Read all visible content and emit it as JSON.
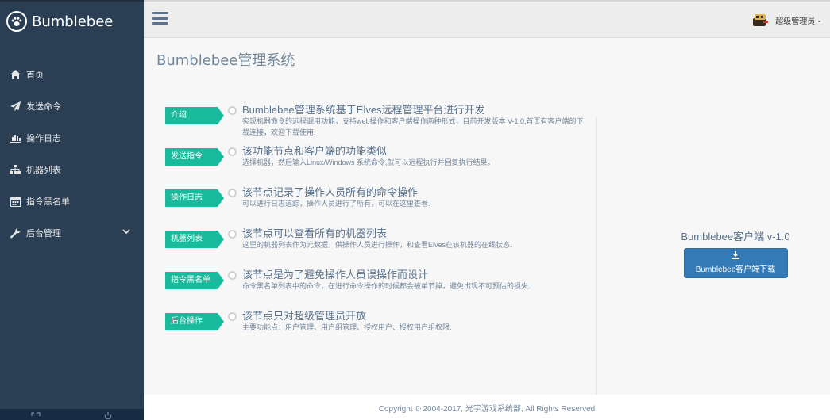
{
  "brand": {
    "name": "Bumblebee",
    "icon": "paw-icon"
  },
  "sidebar": {
    "items": [
      {
        "label": "首页",
        "icon": "home-icon"
      },
      {
        "label": "发送命令",
        "icon": "paper-plane-icon"
      },
      {
        "label": "操作日志",
        "icon": "bar-chart-icon"
      },
      {
        "label": "机器列表",
        "icon": "sitemap-icon"
      },
      {
        "label": "指令黑名单",
        "icon": "calendar-icon"
      },
      {
        "label": "后台管理",
        "icon": "wrench-icon",
        "has_submenu": true
      }
    ]
  },
  "topbar": {
    "user_name": "超级管理员",
    "caret": "⌄"
  },
  "page": {
    "title": "Bumblebee管理系统",
    "timeline": [
      {
        "tag": "介绍",
        "title": "Bumblebee管理系统基于Elves远程管理平台进行开发",
        "desc": "实现机器命令的远程调用功能，支持web操作和客户端操作两种形式，目前开发版本 V-1.0,首页有客户端的下载连接，欢迎下载使用."
      },
      {
        "tag": "发送指令",
        "title": "该功能节点和客户端的功能类似",
        "desc": "选择机器，然后输入Linux/Windows 系统命令,就可以远程执行并回复执行结果。"
      },
      {
        "tag": "操作日志",
        "title": "该节点记录了操作人员所有的命令操作",
        "desc": "可以进行日志追踪，操作人员进行了所有，可以在这里查看."
      },
      {
        "tag": "机器列表",
        "title": "该节点可以查看所有的机器列表",
        "desc": "这里的机器列表作为元数据，供操作人员进行操作，和查看Elves在该机器的在线状态."
      },
      {
        "tag": "指令黑名单",
        "title": "该节点是为了避免操作人员误操作而设计",
        "desc": "命令黑名单列表中的命令，在进行命令操作的时候都会被单节掉，避免出现不可预估的损失."
      },
      {
        "tag": "后台操作",
        "title": "该节点只对超级管理员开放",
        "desc": "主要功能点：用户管理、用户组管理、授权用户、授权用户组权限."
      }
    ],
    "download": {
      "title": "Bumblebee客户端 v-1.0",
      "button_label": "Bumblebee客户端下载"
    }
  },
  "footer": {
    "text": "Copyright © 2004-2017, 光宇游戏系统部, All Rights Reserved"
  },
  "colors": {
    "sidebar": "#2a3f54",
    "tag": "#1abb9c",
    "button": "#337ab7"
  }
}
